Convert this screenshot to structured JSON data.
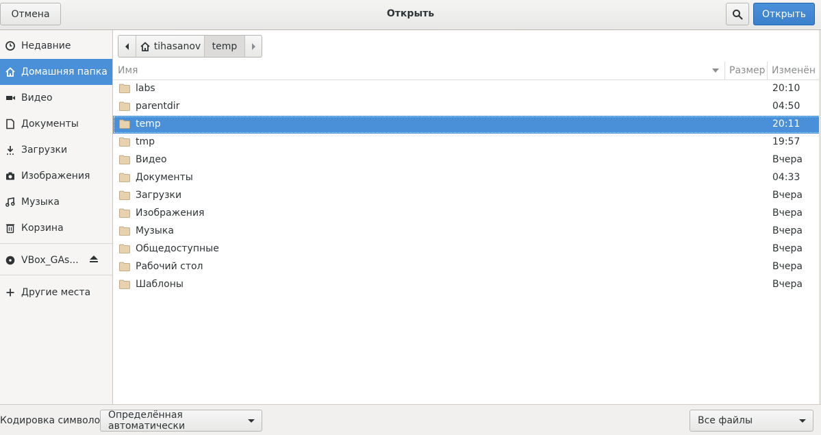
{
  "header": {
    "title": "Открыть",
    "cancel_label": "Отмена",
    "open_label": "Открыть",
    "accent_color": "#4a90d9"
  },
  "sidebar": {
    "items": [
      {
        "label": "Недавние",
        "icon": "clock-icon"
      },
      {
        "label": "Домашняя папка",
        "icon": "home-icon",
        "active": true
      },
      {
        "label": "Видео",
        "icon": "video-icon"
      },
      {
        "label": "Документы",
        "icon": "document-icon"
      },
      {
        "label": "Загрузки",
        "icon": "download-icon"
      },
      {
        "label": "Изображения",
        "icon": "camera-icon"
      },
      {
        "label": "Музыка",
        "icon": "music-icon"
      },
      {
        "label": "Корзина",
        "icon": "trash-icon"
      },
      {
        "label": "VBox_GAs...",
        "icon": "disc-icon"
      },
      {
        "label": "Другие места",
        "icon": "plus-icon"
      }
    ]
  },
  "pathbar": {
    "segments": [
      "tihasanov",
      "temp"
    ]
  },
  "list": {
    "columns": {
      "name": "Имя",
      "size": "Размер",
      "modified": "Изменён"
    },
    "rows": [
      {
        "name": "labs",
        "modified": "20:10"
      },
      {
        "name": "parentdir",
        "modified": "04:50"
      },
      {
        "name": "temp",
        "modified": "20:11",
        "selected": true
      },
      {
        "name": "tmp",
        "modified": "19:57"
      },
      {
        "name": "Видео",
        "modified": "Вчера"
      },
      {
        "name": "Документы",
        "modified": "04:33"
      },
      {
        "name": "Загрузки",
        "modified": "Вчера"
      },
      {
        "name": "Изображения",
        "modified": "Вчера"
      },
      {
        "name": "Музыка",
        "modified": "Вчера"
      },
      {
        "name": "Общедоступные",
        "modified": "Вчера"
      },
      {
        "name": "Рабочий стол",
        "modified": "Вчера"
      },
      {
        "name": "Шаблоны",
        "modified": "Вчера"
      }
    ]
  },
  "footer": {
    "encoding_label": "Кодировка символов:",
    "encoding_value": "Определённая автоматически",
    "filter_value": "Все файлы"
  }
}
